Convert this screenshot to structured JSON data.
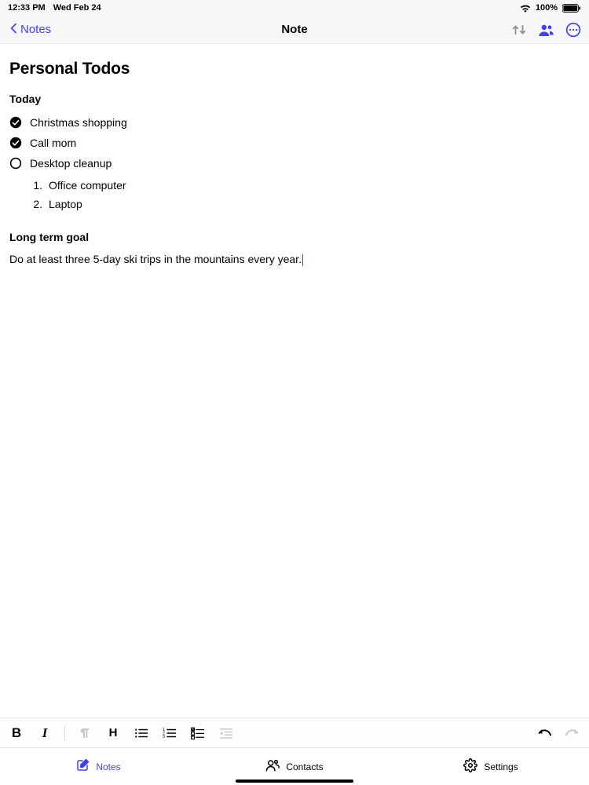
{
  "status": {
    "time": "12:33 PM",
    "date": "Wed Feb 24",
    "battery": "100%"
  },
  "nav": {
    "back_label": "Notes",
    "title": "Note"
  },
  "note": {
    "title": "Personal Todos",
    "sections": {
      "today_heading": "Today",
      "todos": [
        {
          "label": "Christmas shopping",
          "done": true
        },
        {
          "label": "Call mom",
          "done": true
        },
        {
          "label": "Desktop cleanup",
          "done": false
        }
      ],
      "subitems": [
        "Office computer",
        "Laptop"
      ],
      "longterm_heading": "Long term goal",
      "longterm_text": "Do at least three 5-day ski trips in the mountains every year."
    }
  },
  "tabs": {
    "notes": "Notes",
    "contacts": "Contacts",
    "settings": "Settings"
  }
}
